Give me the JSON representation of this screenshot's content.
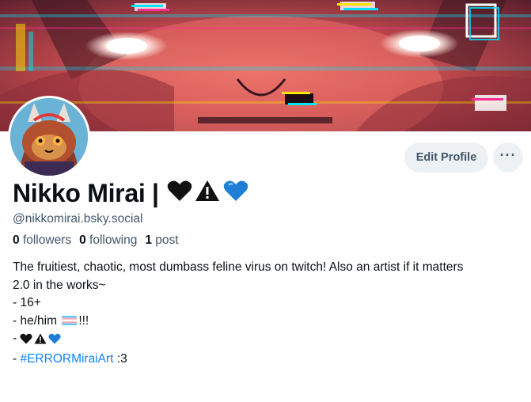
{
  "profile": {
    "display_name": "Nikko Mirai |",
    "handle": "@nikkomirai.bsky.social",
    "followers_count": "0",
    "followers_label": "followers",
    "following_count": "0",
    "following_label": "following",
    "posts_count": "1",
    "posts_label": "post",
    "emoji_icons": [
      "black-heart-icon",
      "warning-sign-icon",
      "blue-heart-icon"
    ],
    "bio": {
      "line1": "The fruitiest, chaotic, most dumbass feline virus on twitch! Also an artist if it matters",
      "line2": "2.0 in the works~",
      "line3": "- 16+",
      "line4_prefix": "- he/him ",
      "line4_suffix": "!!!",
      "line5_prefix": "- ",
      "line6_prefix": "- ",
      "hashtag": "#ERRORMiraiArt",
      "line6_suffix": " :3"
    }
  },
  "actions": {
    "edit_label": "Edit Profile",
    "more_label": "···"
  },
  "colors": {
    "accent": "#1083fe",
    "muted_text": "#42576c",
    "button_bg": "#eef1f4"
  }
}
